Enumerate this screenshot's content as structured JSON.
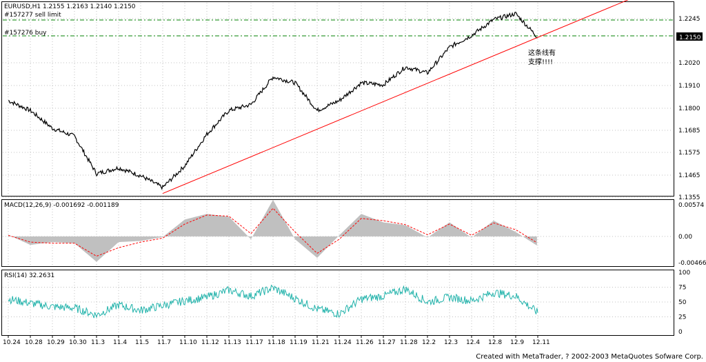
{
  "main": {
    "title": "EURUSD,H1  1.2155 1.2163 1.2140 1.2150",
    "orders": [
      {
        "label": "#157277 sell limit",
        "price": 1.2245
      },
      {
        "label": "#157276 buy",
        "price": 1.215
      }
    ],
    "current_price": "1.2150",
    "annotation": [
      "这条线有",
      "支撑!!!!"
    ]
  },
  "macd": {
    "title": "MACD(12,26,9)  -0.001692  -0.001189"
  },
  "rsi": {
    "title": "RSI(14)  32.2631"
  },
  "footer": "Created with MetaTrader, ? 2002-2003 MetaQuotes Sofware Corp.",
  "colors": {
    "price": "#000000",
    "trend": "#ff0000",
    "order": "#008000",
    "macd_hist": "#c0c0c0",
    "macd_signal": "#ff0000",
    "rsi": "#20b2aa",
    "grid": "#c0c0c0"
  },
  "chart_data": [
    {
      "type": "line",
      "title": "EURUSD,H1",
      "yticks": [
        "1.2245",
        "1.2150",
        "1.2020",
        "1.1910",
        "1.1800",
        "1.1685",
        "1.1575",
        "1.1465",
        "1.1355"
      ],
      "ylim": [
        1.1355,
        1.2245
      ],
      "x": [
        "10.24",
        "10.28",
        "10.29",
        "10.30",
        "11.3",
        "11.4",
        "11.5",
        "11.7",
        "11.10",
        "11.12",
        "11.13",
        "11.17",
        "11.18",
        "11.19",
        "11.21",
        "11.24",
        "11.26",
        "11.27",
        "11.28",
        "12.2",
        "12.3",
        "12.4",
        "12.8",
        "12.9",
        "12.11"
      ],
      "series": [
        {
          "values": [
            1.183,
            1.178,
            1.169,
            1.165,
            1.146,
            1.149,
            1.145,
            1.139,
            1.15,
            1.166,
            1.178,
            1.181,
            1.195,
            1.192,
            1.178,
            1.183,
            1.192,
            1.191,
            1.2,
            1.197,
            1.21,
            1.216,
            1.224,
            1.227,
            1.215
          ]
        }
      ],
      "trendline": {
        "from": [
          "11.7",
          1.136
        ],
        "to": [
          "12.11",
          1.215
        ]
      },
      "grid": true
    },
    {
      "type": "bar",
      "title": "MACD(12,26,9)",
      "yticks": [
        "0.00574",
        "0.00",
        "-0.00466"
      ],
      "ylim": [
        -0.00466,
        0.00574
      ],
      "series": [
        {
          "name": "MACD",
          "values": [
            0.0003,
            -0.0015,
            -0.001,
            -0.0012,
            -0.0045,
            -0.001,
            -0.0008,
            -0.0001,
            0.003,
            0.004,
            0.0035,
            -0.0005,
            0.0065,
            -0.0005,
            -0.0038,
            0.0002,
            0.004,
            0.0025,
            0.002,
            -0.0002,
            0.0025,
            -0.0002,
            0.0028,
            0.0008,
            -0.0017
          ]
        },
        {
          "name": "Signal",
          "values": [
            0.0002,
            -0.001,
            -0.0012,
            -0.0012,
            -0.0035,
            -0.002,
            -0.001,
            -0.0003,
            0.0022,
            0.0038,
            0.0036,
            0.0005,
            0.005,
            0.0008,
            -0.003,
            -0.0005,
            0.0032,
            0.0028,
            0.0021,
            0.0003,
            0.0022,
            0.0002,
            0.0024,
            0.0012,
            -0.0012
          ]
        }
      ]
    },
    {
      "type": "line",
      "title": "RSI(14)",
      "yticks": [
        "100",
        "75",
        "50",
        "25",
        "0"
      ],
      "ylim": [
        0,
        100
      ],
      "series": [
        {
          "values": [
            55,
            48,
            42,
            40,
            28,
            45,
            36,
            44,
            52,
            58,
            70,
            60,
            74,
            56,
            38,
            30,
            55,
            60,
            72,
            50,
            58,
            52,
            66,
            60,
            32
          ]
        }
      ]
    }
  ]
}
